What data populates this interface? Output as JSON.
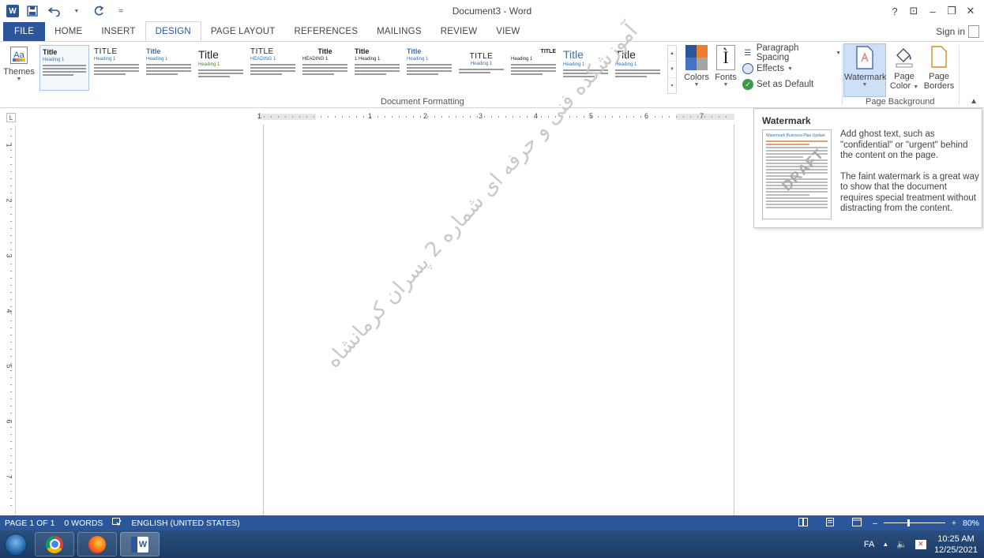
{
  "titlebar": {
    "title": "Document3 - Word",
    "app_logo": "W",
    "qat": {
      "save_icon": "save-icon",
      "undo_icon": "undo-icon",
      "redo_icon": "redo-icon",
      "customize_icon": "customize-qat-icon"
    },
    "controls": {
      "help": "?",
      "ribbon_opts": "⊡",
      "minimize": "–",
      "restore": "❐",
      "close": "✕"
    }
  },
  "tabs": [
    {
      "label": "FILE"
    },
    {
      "label": "HOME"
    },
    {
      "label": "INSERT"
    },
    {
      "label": "DESIGN"
    },
    {
      "label": "PAGE LAYOUT"
    },
    {
      "label": "REFERENCES"
    },
    {
      "label": "MAILINGS"
    },
    {
      "label": "REVIEW"
    },
    {
      "label": "VIEW"
    }
  ],
  "active_tab": "DESIGN",
  "signin": "Sign in",
  "ribbon": {
    "themes_label": "Themes",
    "themes_icon_text": "Aa",
    "styles": [
      {
        "title": "Title",
        "heading": "Heading 1"
      },
      {
        "title": "TITLE",
        "heading": "Heading 1"
      },
      {
        "title": "Title",
        "heading": "Heading 1"
      },
      {
        "title": "Title",
        "heading": "Heading 1"
      },
      {
        "title": "TITLE",
        "heading": "HEADING 1"
      },
      {
        "title": "Title",
        "heading": "HEADING 1"
      },
      {
        "title": "Title",
        "heading": "1 Heading 1"
      },
      {
        "title": "Title",
        "heading": "Heading 1"
      },
      {
        "title": "TITLE",
        "heading": "Heading 1"
      },
      {
        "title": "TITLE",
        "heading": "Heading 1"
      },
      {
        "title": "Title",
        "heading": "Heading 1"
      },
      {
        "title": "Title",
        "heading": "Heading 1"
      }
    ],
    "colors_label": "Colors",
    "fonts_label": "Fonts",
    "paragraph_spacing": "Paragraph Spacing",
    "effects": "Effects",
    "set_default": "Set as Default",
    "group_document_formatting": "Document Formatting",
    "watermark_label": "Watermark",
    "page_color_label1": "Page",
    "page_color_label2": "Color",
    "page_borders_label1": "Page",
    "page_borders_label2": "Borders",
    "group_page_background": "Page Background",
    "theme_colors": [
      "#2b579a",
      "#ed7d31",
      "#4472c4",
      "#a5a5a5"
    ]
  },
  "ruler": {
    "h_numbers": [
      "1",
      "1",
      "2",
      "3",
      "4",
      "5",
      "6",
      "7"
    ],
    "v_numbers": [
      "1",
      "2",
      "3",
      "4",
      "5",
      "6",
      "7"
    ]
  },
  "watermark_text": "آموزشکده فنی و حرفه ای شماره 2 پسران کرمانشاه",
  "tooltip": {
    "title": "Watermark",
    "preview_title": "Watermark Business Plan Update",
    "preview_watermark": "DRAFT",
    "p1": "Add ghost text, such as \"confidential\" or \"urgent\" behind the content on the page.",
    "p2": "The faint watermark is a great way to show that the document requires special treatment without distracting from the content."
  },
  "statusbar": {
    "page": "PAGE 1 OF 1",
    "words": "0 WORDS",
    "language": "ENGLISH (UNITED STATES)",
    "zoom_minus": "–",
    "zoom_plus": "+",
    "zoom": "80%",
    "zoom_level": 0.8
  },
  "taskbar": {
    "lang": "FA",
    "time": "10:25 AM",
    "date": "12/25/2021",
    "apps": [
      "chrome",
      "firefox",
      "word"
    ]
  },
  "colors": {
    "accent": "#2b579a"
  }
}
